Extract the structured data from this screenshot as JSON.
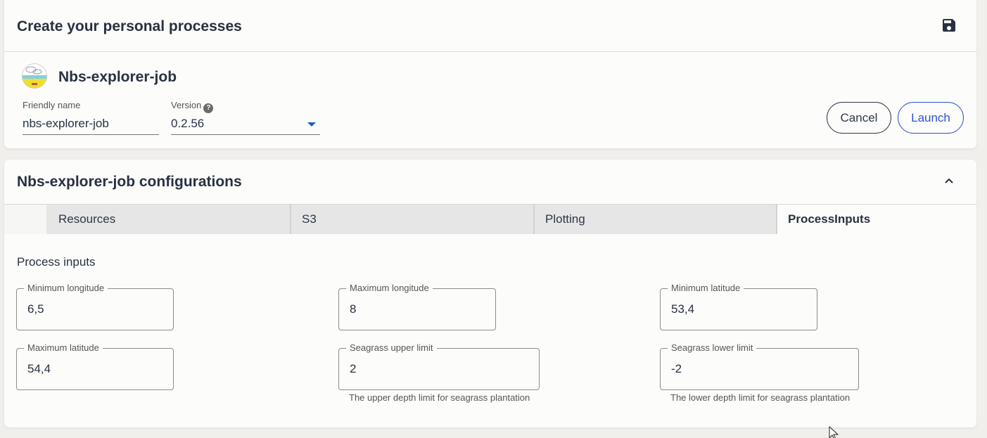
{
  "header": {
    "title": "Create your personal processes",
    "save_icon": "save-icon"
  },
  "job": {
    "title": "Nbs-explorer-job",
    "logo_icon": "nbs-logo-icon",
    "friendly_name": {
      "label": "Friendly name",
      "value": "nbs-explorer-job"
    },
    "version": {
      "label": "Version",
      "help": "?",
      "value": "0.2.56"
    },
    "cancel_label": "Cancel",
    "launch_label": "Launch"
  },
  "config": {
    "title": "Nbs-explorer-job configurations",
    "collapse_icon": "chevron-up-icon",
    "tabs": [
      {
        "label": "Resources",
        "active": false
      },
      {
        "label": "S3",
        "active": false
      },
      {
        "label": "Plotting",
        "active": false
      },
      {
        "label": "ProcessInputs",
        "active": true
      }
    ],
    "section_title": "Process inputs",
    "fields": [
      {
        "label": "Minimum longitude",
        "value": "6,5",
        "helper": ""
      },
      {
        "label": "Maximum longitude",
        "value": "8",
        "helper": ""
      },
      {
        "label": "Minimum latitude",
        "value": "53,4",
        "helper": ""
      },
      {
        "label": "Maximum latitude",
        "value": "54,4",
        "helper": ""
      },
      {
        "label": "Seagrass upper limit",
        "value": "2",
        "helper": "The upper depth limit for seagrass plantation"
      },
      {
        "label": "Seagrass lower limit",
        "value": "-2",
        "helper": "The lower depth limit for seagrass plantation"
      }
    ]
  },
  "colors": {
    "primary": "#2c55c8",
    "dropdown_arrow": "#1d5fd0",
    "text": "#283142",
    "tab_inactive_bg": "#e6e6e6"
  }
}
